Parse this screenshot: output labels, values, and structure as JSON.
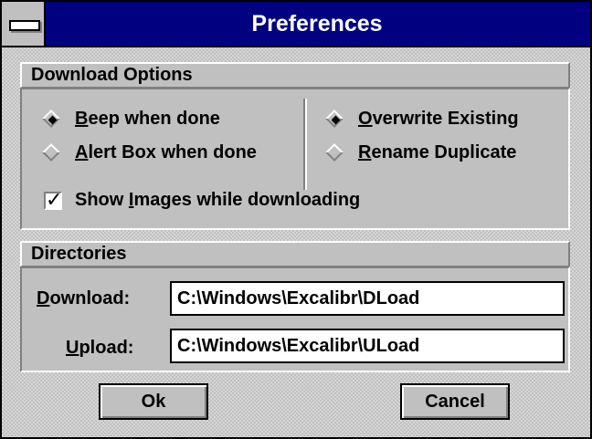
{
  "window": {
    "title": "Preferences"
  },
  "download_options": {
    "header": "Download Options",
    "completion": [
      {
        "label": "Beep when done",
        "underline": "B",
        "selected": true
      },
      {
        "label": "Alert Box when done",
        "underline": "A",
        "selected": false
      }
    ],
    "conflict": [
      {
        "label": "Overwrite Existing",
        "underline": "O",
        "selected": true
      },
      {
        "label": "Rename Duplicate",
        "underline": "R",
        "selected": false
      }
    ],
    "show_images": {
      "label": "Show Images while downloading",
      "underline": "I",
      "checked": true
    }
  },
  "directories": {
    "header": "Directories",
    "download": {
      "label": "Download:",
      "underline": "D",
      "value": "C:\\Windows\\Excalibr\\DLoad"
    },
    "upload": {
      "label": "Upload:",
      "underline": "U",
      "value": "C:\\Windows\\Excalibr\\ULoad"
    }
  },
  "buttons": {
    "ok": "Ok",
    "cancel": "Cancel"
  },
  "colors": {
    "titlebar": "#000080",
    "face": "#c0c0c0"
  }
}
